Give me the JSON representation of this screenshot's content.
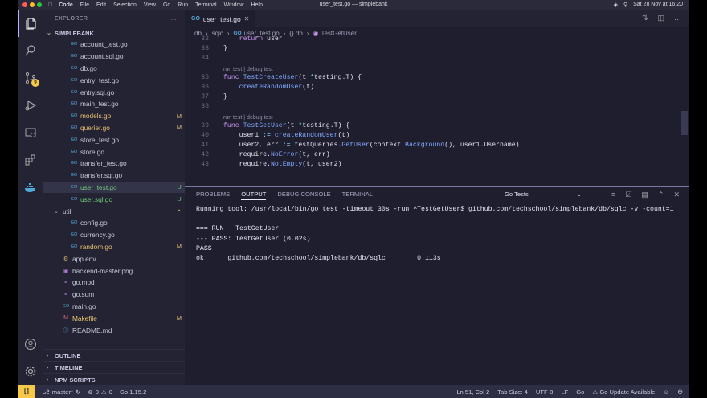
{
  "menubar": {
    "app": "Code",
    "items": [
      "File",
      "Edit",
      "Selection",
      "View",
      "Go",
      "Run",
      "Terminal",
      "Window",
      "Help"
    ],
    "window_title": "user_test.go — simplebank",
    "clock": "Sat 28 Nov at 16:20"
  },
  "activity": {
    "scm_badge": "9"
  },
  "explorer": {
    "title": "EXPLORER",
    "project": "SIMPLEBANK",
    "files": [
      {
        "name": "account_test.go",
        "status": "",
        "kind": "go",
        "indent": 1
      },
      {
        "name": "account.sql.go",
        "status": "",
        "kind": "go",
        "indent": 1
      },
      {
        "name": "db.go",
        "status": "",
        "kind": "go",
        "indent": 1
      },
      {
        "name": "entry_test.go",
        "status": "",
        "kind": "go",
        "indent": 1
      },
      {
        "name": "entry.sql.go",
        "status": "",
        "kind": "go",
        "indent": 1
      },
      {
        "name": "main_test.go",
        "status": "",
        "kind": "go",
        "indent": 1
      },
      {
        "name": "models.go",
        "status": "M",
        "kind": "go",
        "indent": 1
      },
      {
        "name": "querier.go",
        "status": "M",
        "kind": "go",
        "indent": 1
      },
      {
        "name": "store_test.go",
        "status": "",
        "kind": "go",
        "indent": 1
      },
      {
        "name": "store.go",
        "status": "",
        "kind": "go",
        "indent": 1
      },
      {
        "name": "transfer_test.go",
        "status": "",
        "kind": "go",
        "indent": 1
      },
      {
        "name": "transfer.sql.go",
        "status": "",
        "kind": "go",
        "indent": 1
      },
      {
        "name": "user_test.go",
        "status": "U",
        "kind": "go",
        "indent": 1,
        "selected": true
      },
      {
        "name": "user.sql.go",
        "status": "U",
        "kind": "go",
        "indent": 1
      },
      {
        "name": "util",
        "status": "•",
        "kind": "folder",
        "indent": 0
      },
      {
        "name": "config.go",
        "status": "",
        "kind": "go",
        "indent": 1
      },
      {
        "name": "currency.go",
        "status": "",
        "kind": "go",
        "indent": 1
      },
      {
        "name": "random.go",
        "status": "M",
        "kind": "go",
        "indent": 1
      },
      {
        "name": "app.env",
        "status": "",
        "kind": "env",
        "indent": 0
      },
      {
        "name": "backend-master.png",
        "status": "",
        "kind": "img",
        "indent": 0
      },
      {
        "name": "go.mod",
        "status": "",
        "kind": "mod",
        "indent": 0
      },
      {
        "name": "go.sum",
        "status": "",
        "kind": "mod",
        "indent": 0
      },
      {
        "name": "main.go",
        "status": "",
        "kind": "go",
        "indent": 0
      },
      {
        "name": "Makefile",
        "status": "M",
        "kind": "make",
        "indent": 0
      },
      {
        "name": "README.md",
        "status": "",
        "kind": "md",
        "indent": 0
      }
    ],
    "sections": [
      "OUTLINE",
      "TIMELINE",
      "NPM SCRIPTS"
    ]
  },
  "editor": {
    "tab": "user_test.go",
    "breadcrumbs": [
      "db",
      "sqlc",
      "user_test.go",
      "{} db",
      "TestGetUser"
    ],
    "lines": [
      {
        "n": "32",
        "code": "    return user"
      },
      {
        "n": "33",
        "code": "}"
      },
      {
        "n": "34",
        "code": ""
      },
      {
        "lens": "run test | debug test"
      },
      {
        "n": "35",
        "code": "func TestCreateUser(t *testing.T) {"
      },
      {
        "n": "36",
        "code": "    createRandomUser(t)"
      },
      {
        "n": "37",
        "code": "}"
      },
      {
        "n": "38",
        "code": ""
      },
      {
        "lens": "run test | debug test"
      },
      {
        "n": "39",
        "code": "func TestGetUser(t *testing.T) {"
      },
      {
        "n": "40",
        "code": "    user1 := createRandomUser(t)"
      },
      {
        "n": "41",
        "code": "    user2, err := testQueries.GetUser(context.Background(), user1.Username)"
      },
      {
        "n": "42",
        "code": "    require.NoError(t, err)"
      },
      {
        "n": "43",
        "code": "    require.NotEmpty(t, user2)"
      }
    ]
  },
  "panel": {
    "tabs": [
      "PROBLEMS",
      "OUTPUT",
      "DEBUG CONSOLE",
      "TERMINAL"
    ],
    "active_tab": "OUTPUT",
    "channel": "Go Tests",
    "output": [
      "Running tool: /usr/local/bin/go test -timeout 30s -run ^TestGetUser$ github.com/techschool/simplebank/db/sqlc -v -count=1",
      "",
      "=== RUN   TestGetUser",
      "--- PASS: TestGetUser (0.02s)",
      "PASS",
      "ok  \tgithub.com/techschool/simplebank/db/sqlc\t0.113s"
    ]
  },
  "status": {
    "branch": "master*",
    "errors": "0",
    "warnings": "0",
    "go_version": "Go 1.15.2",
    "position": "Ln 51, Col 2",
    "tab_size": "Tab Size: 4",
    "encoding": "UTF-8",
    "eol": "LF",
    "language": "Go",
    "update": "Go Update Available"
  },
  "colors": {
    "accent": "#7a7aff",
    "modified": "#e8c070",
    "untracked": "#72c877",
    "status_remote": "#f7c948"
  }
}
